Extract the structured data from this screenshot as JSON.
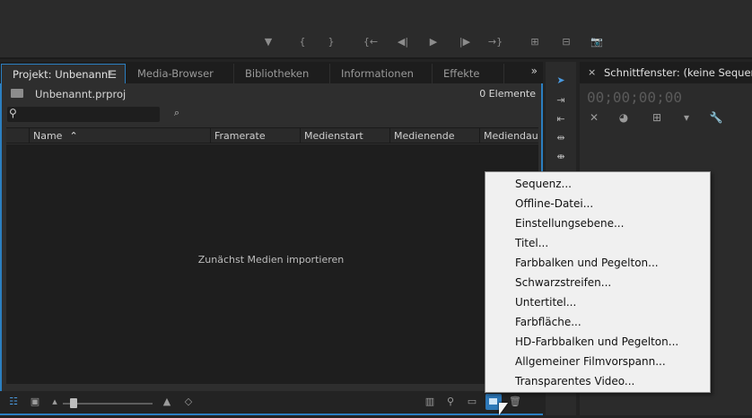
{
  "monitor": {
    "controls": [
      {
        "icon": "add-marker-icon",
        "glyph": "▼"
      },
      {
        "icon": "mark-in-icon",
        "glyph": "{"
      },
      {
        "icon": "mark-out-icon",
        "glyph": "}"
      },
      {
        "icon": "go-to-in-icon",
        "glyph": "{←"
      },
      {
        "icon": "step-back-icon",
        "glyph": "◀|"
      },
      {
        "icon": "play-icon",
        "glyph": "▶"
      },
      {
        "icon": "step-forward-icon",
        "glyph": "|▶"
      },
      {
        "icon": "go-to-out-icon",
        "glyph": "→}"
      },
      {
        "icon": "insert-icon",
        "glyph": "⊞"
      },
      {
        "icon": "overwrite-icon",
        "glyph": "⊟"
      },
      {
        "icon": "export-frame-icon",
        "glyph": "📷"
      }
    ]
  },
  "project": {
    "tabs": [
      {
        "label": "Projekt: Unbenannt",
        "active": true
      },
      {
        "label": "Media-Browser"
      },
      {
        "label": "Bibliotheken"
      },
      {
        "label": "Informationen"
      },
      {
        "label": "Effekte"
      }
    ],
    "menu_glyph": "☰",
    "overflow_glyph": "»",
    "file_name": "Unbenannt.prproj",
    "item_count": "0 Elemente",
    "columns": [
      "Name",
      "Framerate",
      "Medienstart",
      "Medienende",
      "Mediendauer"
    ],
    "sort_glyph": "⌃",
    "empty_message": "Zunächst Medien importieren"
  },
  "timeline": {
    "title": "Schnittfenster: (keine Sequenzen)",
    "timecode": "00;00;00;00",
    "close_glyph": "×"
  },
  "context_menu": {
    "items": [
      "Sequenz...",
      "Offline-Datei...",
      "Einstellungsebene...",
      "Titel...",
      "Farbbalken und Pegelton...",
      "Schwarzstreifen...",
      "Untertitel...",
      "Farbfläche...",
      "HD-Farbbalken und Pegelton...",
      "Allgemeiner Filmvorspann...",
      "Transparentes Video..."
    ]
  },
  "colors": {
    "accent": "#2b7fc1",
    "panel": "#2e2e2e",
    "menu_bg": "#f0f0f0"
  }
}
